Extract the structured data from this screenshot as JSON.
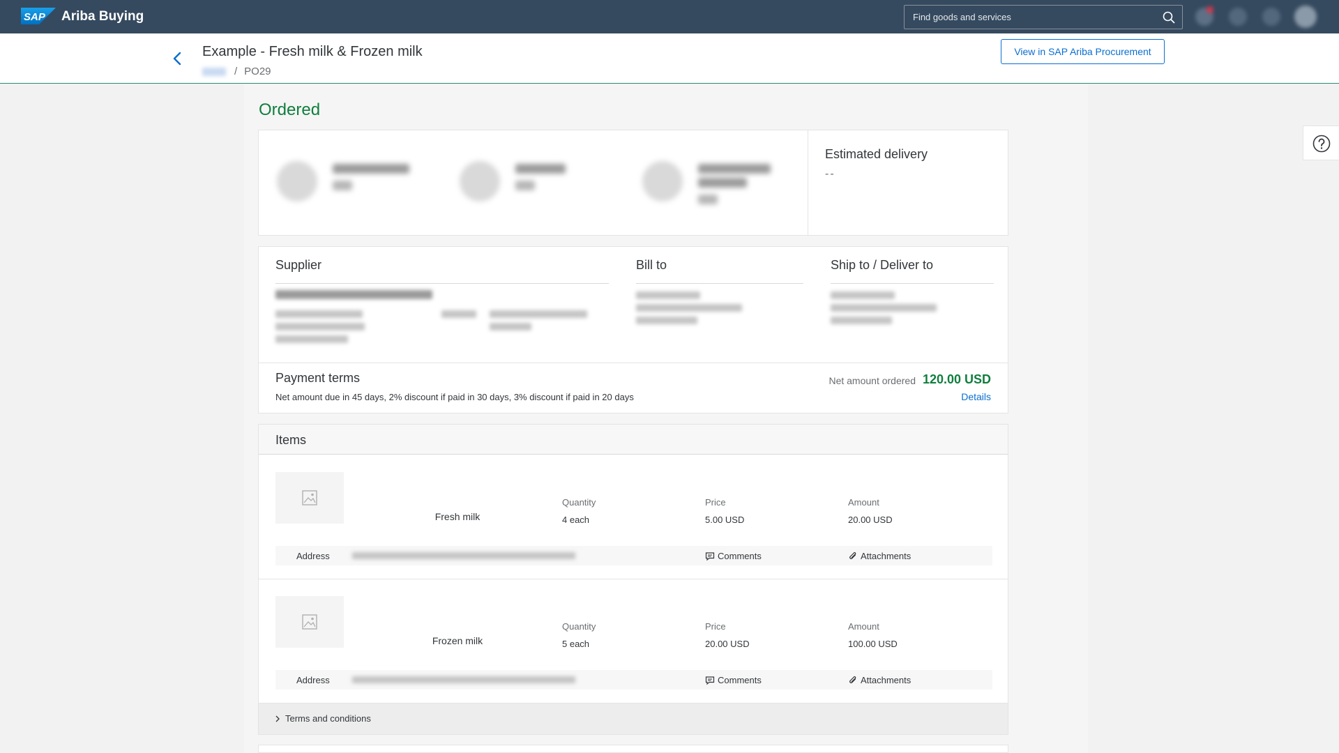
{
  "shell": {
    "logo_text": "SAP",
    "product_name": "Ariba Buying",
    "search_placeholder": "Find goods and services"
  },
  "header": {
    "title": "Example - Fresh milk & Frozen milk",
    "breadcrumb_separator": "/",
    "breadcrumb_current": "PO29",
    "view_button_label": "View in SAP Ariba Procurement"
  },
  "status": {
    "title": "Ordered",
    "estimated_delivery_label": "Estimated delivery",
    "estimated_delivery_value": "--"
  },
  "parties": {
    "supplier_label": "Supplier",
    "bill_to_label": "Bill to",
    "ship_to_label": "Ship to / Deliver to"
  },
  "payment": {
    "title": "Payment terms",
    "terms_text": "Net amount due in 45 days, 2% discount if paid in 30 days, 3% discount if paid in 20 days",
    "net_amount_label": "Net amount ordered",
    "net_amount_value": "120.00 USD",
    "details_link": "Details"
  },
  "items": {
    "title": "Items",
    "quantity_label": "Quantity",
    "price_label": "Price",
    "amount_label": "Amount",
    "address_label": "Address",
    "comments_label": "Comments",
    "attachments_label": "Attachments",
    "rows": [
      {
        "name": "Fresh milk",
        "quantity": "4 each",
        "price": "5.00 USD",
        "amount": "20.00 USD"
      },
      {
        "name": "Frozen milk",
        "quantity": "5 each",
        "price": "20.00 USD",
        "amount": "100.00 USD"
      }
    ],
    "terms_label": "Terms and conditions"
  },
  "colors": {
    "shell": "#354a5f",
    "accent": "#0a6ed1",
    "positive": "#107e3e"
  }
}
